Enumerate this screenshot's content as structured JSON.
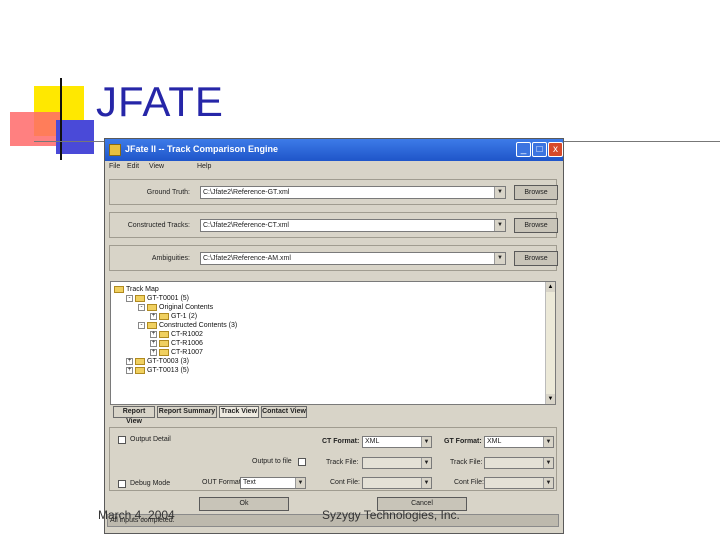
{
  "slide": {
    "title": "JFATE",
    "footer_date": "March 4, 2004",
    "footer_company": "Syzygy Technologies, Inc."
  },
  "window": {
    "title": "JFate II -- Track Comparison Engine",
    "controls": {
      "minimize": "_",
      "maximize": "□",
      "close": "x"
    },
    "menu": [
      "File",
      "Edit",
      "View",
      "Help"
    ]
  },
  "fields": [
    {
      "label": "Ground Truth:",
      "value": "C:\\Jfate2\\Reference-GT.xml",
      "button": "Browse"
    },
    {
      "label": "Constructed Tracks:",
      "value": "C:\\Jfate2\\Reference-CT.xml",
      "button": "Browse"
    },
    {
      "label": "Ambiguities:",
      "value": "C:\\Jfate2\\Reference-AM.xml",
      "button": "Browse"
    }
  ],
  "tree": [
    {
      "depth": 0,
      "expander": "",
      "label": "Track Map"
    },
    {
      "depth": 1,
      "expander": "-",
      "label": "GT-T0001 (5)"
    },
    {
      "depth": 2,
      "expander": "-",
      "label": "Original Contents"
    },
    {
      "depth": 3,
      "expander": "+",
      "label": "GT-1 (2)"
    },
    {
      "depth": 2,
      "expander": "-",
      "label": "Constructed Contents (3)"
    },
    {
      "depth": 3,
      "expander": "+",
      "label": "CT-R1002"
    },
    {
      "depth": 3,
      "expander": "+",
      "label": "CT-R1006"
    },
    {
      "depth": 3,
      "expander": "+",
      "label": "CT-R1007"
    },
    {
      "depth": 1,
      "expander": "+",
      "label": "GT-T0003 (3)"
    },
    {
      "depth": 1,
      "expander": "+",
      "label": "GT-T0013 (5)"
    }
  ],
  "tabs": [
    "Report View",
    "Report Summary",
    "Track View",
    "Contact View"
  ],
  "options": {
    "output_detail": "Output Detail",
    "output_to_file": "Output to file",
    "debug_mode": "Debug Mode",
    "out_format_label": "OUT Format:",
    "out_format_value": "Text",
    "ct_format_label_1": "CT Format:",
    "ct_format_value_1": "XML",
    "ct_format_label_2": "GT Format:",
    "ct_format_value_2": "XML",
    "track_file_label": "Track File:",
    "track_file_2_label": "Track File:",
    "cont_file_label": "Cont File:",
    "cont_file_2_label": "Cont File:"
  },
  "buttons": {
    "ok": "Ok",
    "cancel": "Cancel"
  },
  "status": "All inputs completed.",
  "colors": {
    "title_blue": "#2626a8",
    "titlebar": "#1f55c9",
    "window_bg": "#d8d4c8"
  }
}
